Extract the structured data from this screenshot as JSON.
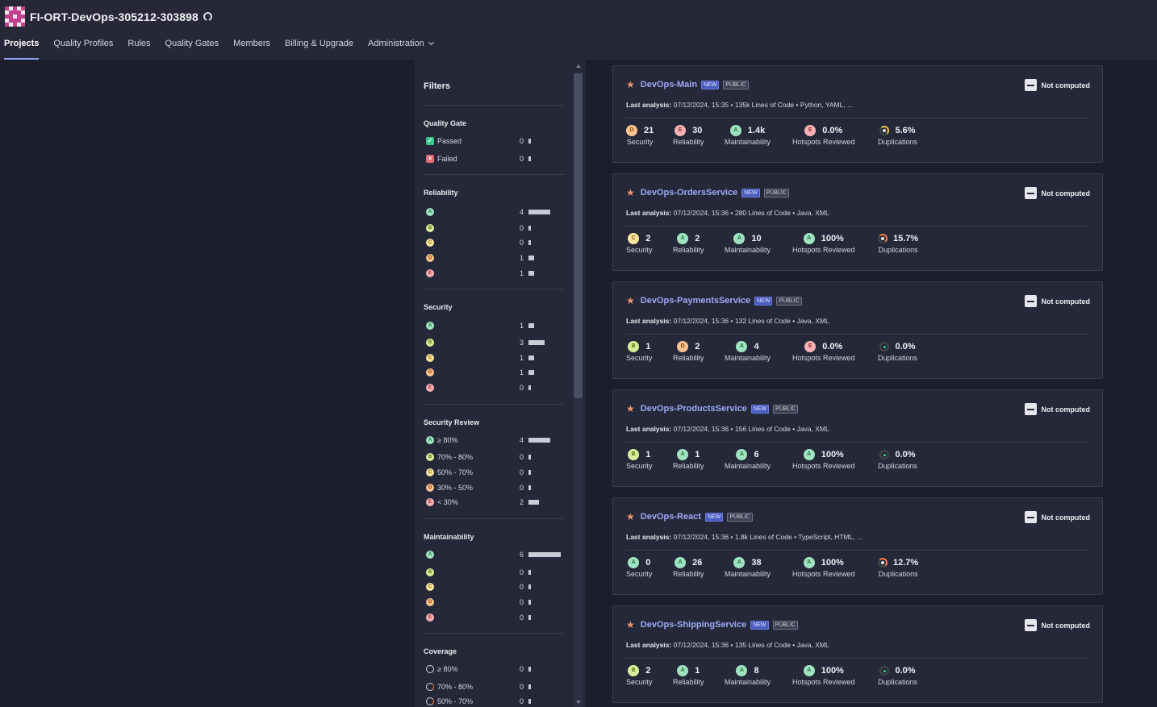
{
  "org": {
    "name": "FI-ORT-DevOps-305212-303898"
  },
  "nav": [
    {
      "label": "Projects"
    },
    {
      "label": "Quality Profiles"
    },
    {
      "label": "Rules"
    },
    {
      "label": "Quality Gates"
    },
    {
      "label": "Members"
    },
    {
      "label": "Billing & Upgrade"
    },
    {
      "label": "Administration"
    }
  ],
  "filters": {
    "title": "Filters",
    "quality_gate": {
      "title": "Quality Gate",
      "rows": [
        {
          "label": "Passed",
          "count": "0"
        },
        {
          "label": "Failed",
          "count": "0"
        }
      ]
    },
    "reliability": {
      "title": "Reliability",
      "rows": [
        {
          "rating": "A",
          "count": "4"
        },
        {
          "rating": "B",
          "count": "0"
        },
        {
          "rating": "C",
          "count": "0"
        },
        {
          "rating": "D",
          "count": "1"
        },
        {
          "rating": "E",
          "count": "1"
        }
      ]
    },
    "security": {
      "title": "Security",
      "rows": [
        {
          "rating": "A",
          "count": "1"
        },
        {
          "rating": "B",
          "count": "3"
        },
        {
          "rating": "C",
          "count": "1"
        },
        {
          "rating": "D",
          "count": "1"
        },
        {
          "rating": "E",
          "count": "0"
        }
      ]
    },
    "security_review": {
      "title": "Security Review",
      "rows": [
        {
          "rating": "A",
          "label": "≥ 80%",
          "count": "4"
        },
        {
          "rating": "B",
          "label": "70% - 80%",
          "count": "0"
        },
        {
          "rating": "C",
          "label": "50% - 70%",
          "count": "0"
        },
        {
          "rating": "D",
          "label": "30% - 50%",
          "count": "0"
        },
        {
          "rating": "E",
          "label": "< 30%",
          "count": "2"
        }
      ]
    },
    "maintainability": {
      "title": "Maintainability",
      "rows": [
        {
          "rating": "A",
          "count": "6"
        },
        {
          "rating": "B",
          "count": "0"
        },
        {
          "rating": "C",
          "count": "0"
        },
        {
          "rating": "D",
          "count": "0"
        },
        {
          "rating": "E",
          "count": "0"
        }
      ]
    },
    "coverage": {
      "title": "Coverage",
      "rows": [
        {
          "label": "≥ 80%",
          "count": "0"
        },
        {
          "label": "70% - 80%",
          "count": "0"
        },
        {
          "label": "50% - 70%",
          "count": "0"
        }
      ]
    }
  },
  "labels": {
    "new": "NEW",
    "public": "PUBLIC",
    "not_computed": "Not computed",
    "last_analysis": "Last analysis:",
    "security": "Security",
    "reliability": "Reliability",
    "maintainability": "Maintainability",
    "hotspots": "Hotspots Reviewed",
    "duplications": "Duplications"
  },
  "projects": [
    {
      "name": "DevOps-Main",
      "analysis": "07/12/2024, 15:35",
      "loc": "135k Lines of Code",
      "langs": "Python, YAML, ...",
      "security": {
        "rating": "D",
        "value": "21"
      },
      "reliability": {
        "rating": "E",
        "value": "30"
      },
      "maintainability": {
        "rating": "A",
        "value": "1.4k"
      },
      "hotspots": {
        "rating": "E",
        "value": "0.0%"
      },
      "duplications": {
        "value": "5.6%",
        "level": "warn"
      }
    },
    {
      "name": "DevOps-OrdersService",
      "analysis": "07/12/2024, 15:36",
      "loc": "280 Lines of Code",
      "langs": "Java, XML",
      "security": {
        "rating": "C",
        "value": "2"
      },
      "reliability": {
        "rating": "A",
        "value": "2"
      },
      "maintainability": {
        "rating": "A",
        "value": "10"
      },
      "hotspots": {
        "rating": "A",
        "value": "100%"
      },
      "duplications": {
        "value": "15.7%",
        "level": "bad"
      }
    },
    {
      "name": "DevOps-PaymentsService",
      "analysis": "07/12/2024, 15:36",
      "loc": "132 Lines of Code",
      "langs": "Java, XML",
      "security": {
        "rating": "B",
        "value": "1"
      },
      "reliability": {
        "rating": "D",
        "value": "2"
      },
      "maintainability": {
        "rating": "A",
        "value": "4"
      },
      "hotspots": {
        "rating": "E",
        "value": "0.0%"
      },
      "duplications": {
        "value": "0.0%",
        "level": "zero"
      }
    },
    {
      "name": "DevOps-ProductsService",
      "analysis": "07/12/2024, 15:36",
      "loc": "156 Lines of Code",
      "langs": "Java, XML",
      "security": {
        "rating": "B",
        "value": "1"
      },
      "reliability": {
        "rating": "A",
        "value": "1"
      },
      "maintainability": {
        "rating": "A",
        "value": "6"
      },
      "hotspots": {
        "rating": "A",
        "value": "100%"
      },
      "duplications": {
        "value": "0.0%",
        "level": "zero"
      }
    },
    {
      "name": "DevOps-React",
      "analysis": "07/12/2024, 15:36",
      "loc": "1.8k Lines of Code",
      "langs": "TypeScript, HTML, ...",
      "security": {
        "rating": "A",
        "value": "0"
      },
      "reliability": {
        "rating": "A",
        "value": "26"
      },
      "maintainability": {
        "rating": "A",
        "value": "38"
      },
      "hotspots": {
        "rating": "A",
        "value": "100%"
      },
      "duplications": {
        "value": "12.7%",
        "level": "bad"
      }
    },
    {
      "name": "DevOps-ShippingService",
      "analysis": "07/12/2024, 15:36",
      "loc": "135 Lines of Code",
      "langs": "Java, XML",
      "security": {
        "rating": "B",
        "value": "2"
      },
      "reliability": {
        "rating": "A",
        "value": "1"
      },
      "maintainability": {
        "rating": "A",
        "value": "8"
      },
      "hotspots": {
        "rating": "A",
        "value": "100%"
      },
      "duplications": {
        "value": "0.0%",
        "level": "zero"
      }
    }
  ]
}
